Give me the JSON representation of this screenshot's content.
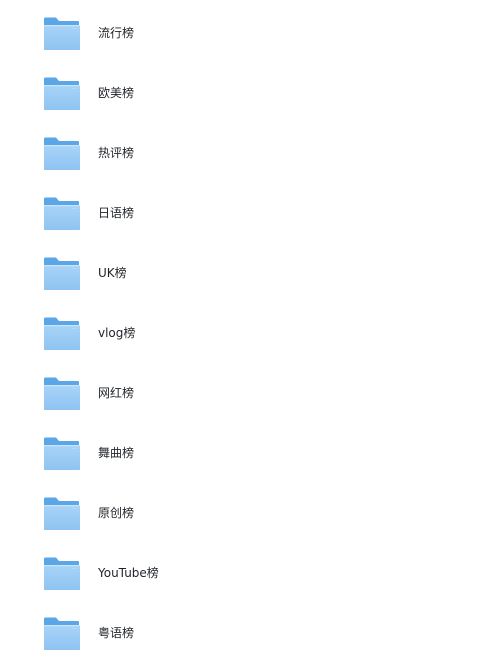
{
  "folder_list": {
    "icon": "folder-icon",
    "colors": {
      "folder_back": "#5aa6e6",
      "folder_front_top": "#a9d3f7",
      "folder_front_bottom": "#8ec4f2",
      "label_text": "#1f2329"
    },
    "items": [
      {
        "label": "流行榜"
      },
      {
        "label": "欧美榜"
      },
      {
        "label": "热评榜"
      },
      {
        "label": "日语榜"
      },
      {
        "label": "UK榜"
      },
      {
        "label": "vlog榜"
      },
      {
        "label": "网红榜"
      },
      {
        "label": "舞曲榜"
      },
      {
        "label": "原创榜"
      },
      {
        "label": "YouTube榜"
      },
      {
        "label": "粤语榜"
      }
    ]
  }
}
